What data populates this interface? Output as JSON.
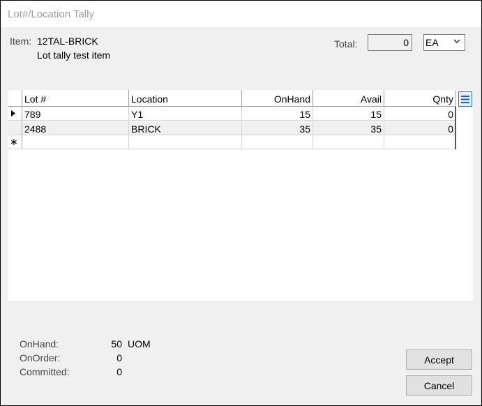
{
  "window": {
    "title": "Lot#/Location Tally"
  },
  "item": {
    "label": "Item:",
    "code": "12TAL-BRICK",
    "description": "Lot tally test item"
  },
  "total": {
    "label": "Total:",
    "value": "0"
  },
  "uom_select": {
    "selected": "EA"
  },
  "grid": {
    "columns": [
      "Lot #",
      "Location",
      "OnHand",
      "Avail",
      "Qnty"
    ],
    "rows": [
      {
        "lot": "789",
        "location": "Y1",
        "onhand": "15",
        "avail": "15",
        "qnty": "0"
      },
      {
        "lot": "2488",
        "location": "BRICK",
        "onhand": "35",
        "avail": "35",
        "qnty": "0"
      }
    ],
    "new_row_marker": "∗",
    "icon": "column-chooser-icon"
  },
  "stats": {
    "onhand_label": "OnHand:",
    "onhand_value": "50",
    "onhand_uom": "UOM",
    "onorder_label": "OnOrder:",
    "onorder_value": "0",
    "committed_label": "Committed:",
    "committed_value": "0"
  },
  "buttons": {
    "accept": "Accept",
    "cancel": "Cancel"
  }
}
